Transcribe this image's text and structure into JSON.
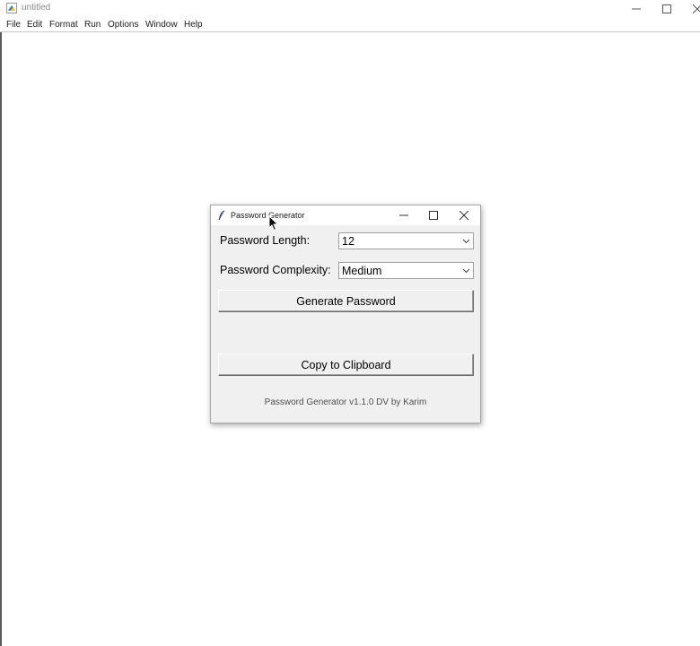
{
  "main_window": {
    "title": "untitled",
    "icon": "python-idle-icon",
    "controls": [
      "minimize-icon",
      "maximize-icon",
      "close-icon"
    ]
  },
  "menubar": {
    "items": [
      "File",
      "Edit",
      "Format",
      "Run",
      "Options",
      "Window",
      "Help"
    ]
  },
  "dialog": {
    "title": "Password Generator",
    "icon": "feather-icon",
    "controls": [
      "minimize-icon",
      "maximize-icon",
      "close-icon"
    ],
    "length_label": "Password Length:",
    "length_value": "12",
    "complexity_label": "Password Complexity:",
    "complexity_value": "Medium",
    "generate_button": "Generate Password",
    "copy_button": "Copy to Clipboard",
    "footer": "Password Generator v1.1.0 DV by Karim"
  },
  "colors": {
    "dialog_bg": "#f0f0f0",
    "title_gray": "#8a8a8a",
    "border": "#a0a0a0"
  }
}
